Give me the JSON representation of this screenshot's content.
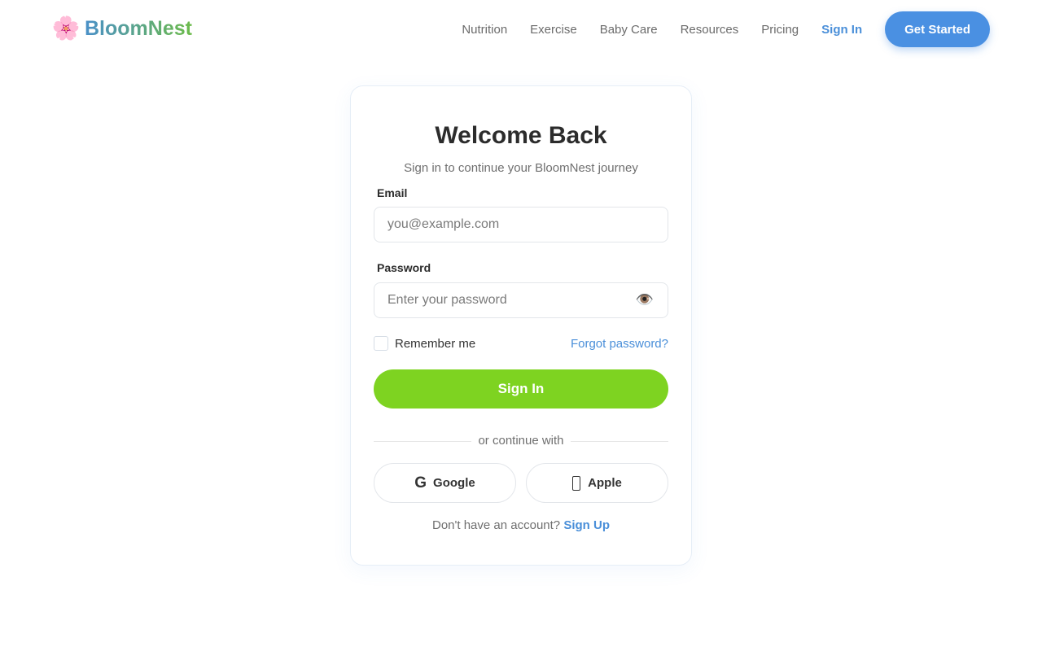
{
  "brand": {
    "name": "BloomNest",
    "icon": "flower-icon",
    "icon_glyph": "🌸"
  },
  "nav": {
    "links": [
      "Nutrition",
      "Exercise",
      "Baby Care",
      "Resources",
      "Pricing"
    ],
    "signin_label": "Sign In",
    "cta_label": "Get Started"
  },
  "login": {
    "title": "Welcome Back",
    "subtitle": "Sign in to continue your BloomNest journey",
    "email_label": "Email",
    "email_placeholder": "you@example.com",
    "email_value": "",
    "password_label": "Password",
    "password_placeholder": "Enter your password",
    "password_value": "",
    "eye_icon": "eye-icon",
    "eye_glyph": "👁️",
    "remember_label": "Remember me",
    "remember_checked": false,
    "forgot_label": "Forgot password?",
    "submit_label": "Sign In",
    "divider_text": "or continue with",
    "google_glyph": "G",
    "google_label": "Google",
    "apple_label": "Apple",
    "footer_prompt": "Don't have an account?",
    "footer_link": "Sign Up"
  },
  "colors": {
    "accent_blue": "#4a90e2",
    "primary_green": "#7ed321",
    "link_blue": "#4a8fd9"
  }
}
